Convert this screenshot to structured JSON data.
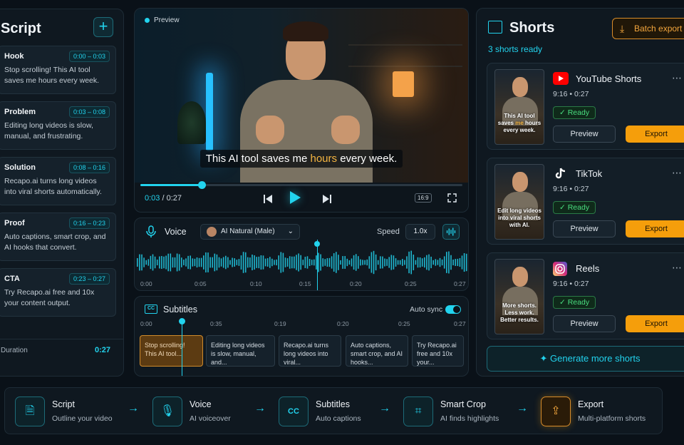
{
  "script": {
    "title": "Script",
    "add_label": "+",
    "segments": [
      {
        "label": "Hook",
        "time": "0:00 – 0:03",
        "text": "Stop scrolling! This AI tool saves me hours every week."
      },
      {
        "label": "Problem",
        "time": "0:03 – 0:08",
        "text": "Editing long videos is slow, manual, and frustrating."
      },
      {
        "label": "Solution",
        "time": "0:08 – 0:16",
        "text": "Recapo.ai turns long videos into viral shorts automatically."
      },
      {
        "label": "Proof",
        "time": "0:16 – 0:23",
        "text": "Auto captions, smart crop, and AI hooks that convert."
      },
      {
        "label": "CTA",
        "time": "0:23 – 0:27",
        "text": "Try Recapo.ai free and 10x your content output."
      }
    ],
    "duration_label": "Duration",
    "duration_value": "0:27"
  },
  "preview": {
    "label": "Preview",
    "caption_pre": "This AI tool saves me ",
    "caption_hl": "hours",
    "caption_post": " every week.",
    "current_time": "0:03",
    "sep": "/",
    "total_time": "0:27",
    "progress": 0.19,
    "aspect": "16:9"
  },
  "voice": {
    "title": "Voice",
    "selected": "AI Natural (Male)",
    "speed_label": "Speed",
    "speed_value": "1.0x",
    "ticks": [
      "0:00",
      "0:05",
      "0:10",
      "0:15",
      "0:20",
      "0:25",
      "0:27"
    ],
    "playhead": 0.545
  },
  "subtitles": {
    "title": "Subtitles",
    "autosync_label": "Auto sync",
    "ticks": [
      "0:00",
      "0:35",
      "0:19",
      "0:20",
      "0:25",
      "0:27"
    ],
    "chips": [
      "Stop scrolling! This AI tool...",
      "Editing long videos is slow, manual, and...",
      "Recapo.ai turns long videos into viral...",
      "Auto captions, smart crop, and AI hooks...",
      "Try Recapo.ai free and 10x your..."
    ]
  },
  "shorts": {
    "title": "Shorts",
    "batch_label": "Batch export",
    "ready_count": "3 shorts ready",
    "items": [
      {
        "platform": "YouTube Shorts",
        "ratio": "9:16",
        "dot": "•",
        "duration": "0:27",
        "status": "Ready",
        "preview": "Preview",
        "export": "Export",
        "thumb_pre": "This AI tool saves ",
        "thumb_hl": "me",
        "thumb_post": " hours every week.",
        "color": "#ff0000"
      },
      {
        "platform": "TikTok",
        "ratio": "9:16",
        "dot": "•",
        "duration": "0:27",
        "status": "Ready",
        "preview": "Preview",
        "export": "Export",
        "thumb_pre": "Edit long videos into viral shorts with AI.",
        "thumb_hl": "",
        "thumb_post": "",
        "color": "#111111"
      },
      {
        "platform": "Reels",
        "ratio": "9:16",
        "dot": "•",
        "duration": "0:27",
        "status": "Ready",
        "preview": "Preview",
        "export": "Export",
        "thumb_pre": "More shorts. Less work. Better results.",
        "thumb_hl": "",
        "thumb_post": "",
        "color": "#d62976"
      }
    ],
    "generate_label": "Generate more shorts"
  },
  "workflow": {
    "steps": [
      {
        "name": "Script",
        "desc": "Outline your video",
        "icon": "doc-icon"
      },
      {
        "name": "Voice",
        "desc": "AI voiceover",
        "icon": "mic-icon"
      },
      {
        "name": "Subtitles",
        "desc": "Auto captions",
        "icon": "cc-icon"
      },
      {
        "name": "Smart Crop",
        "desc": "AI finds highlights",
        "icon": "crop-icon"
      },
      {
        "name": "Export",
        "desc": "Multi-platform shorts",
        "icon": "upload-icon"
      }
    ]
  },
  "colors": {
    "accent": "#22d3ee",
    "export": "#f59e0b",
    "ready": "#4ade80"
  }
}
